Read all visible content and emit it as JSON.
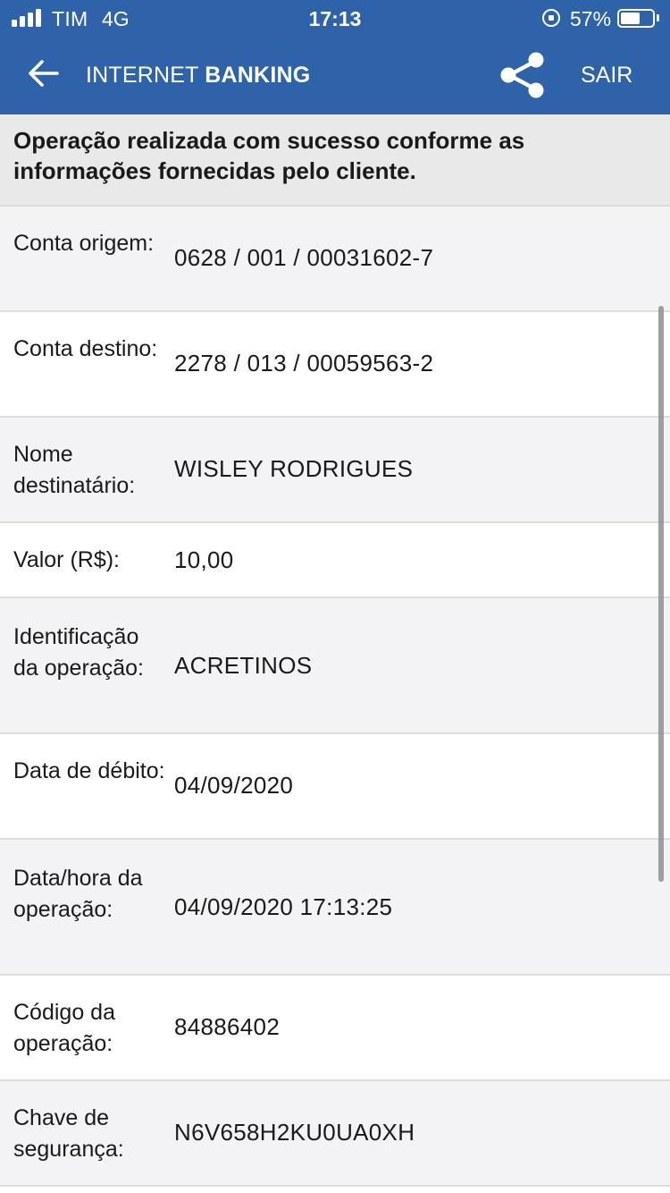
{
  "status_bar": {
    "carrier": "TIM",
    "network": "4G",
    "time": "17:13",
    "battery": "57%",
    "icons": [
      "signal-icon",
      "orientation-lock-icon",
      "battery-icon"
    ]
  },
  "header": {
    "title_regular": "INTERNET ",
    "title_bold": "BANKING",
    "logout_label": "SAIR",
    "icons": [
      "back-arrow-icon",
      "share-icon"
    ],
    "brand_color": "#2f63a9"
  },
  "banner": {
    "message": "Operação realizada com sucesso conforme as informações fornecidas pelo cliente."
  },
  "details": [
    {
      "label": "Conta origem:",
      "value": "0628 / 001 / 00031602-7"
    },
    {
      "label": "Conta destino:",
      "value": "2278 / 013 / 00059563-2"
    },
    {
      "label": "Nome destinatário:",
      "value": "WISLEY RODRIGUES"
    },
    {
      "label": "Valor (R$):",
      "value": "10,00"
    },
    {
      "label": "Identificação da operação:",
      "value": "ACRETINOS"
    },
    {
      "label": "Data de débito:",
      "value": "04/09/2020"
    },
    {
      "label": "Data/hora da operação:",
      "value": "04/09/2020 17:13:25"
    },
    {
      "label": "Código da operação:",
      "value": "84886402"
    },
    {
      "label": "Chave de segurança:",
      "value": "N6V658H2KU0UA0XH"
    }
  ]
}
